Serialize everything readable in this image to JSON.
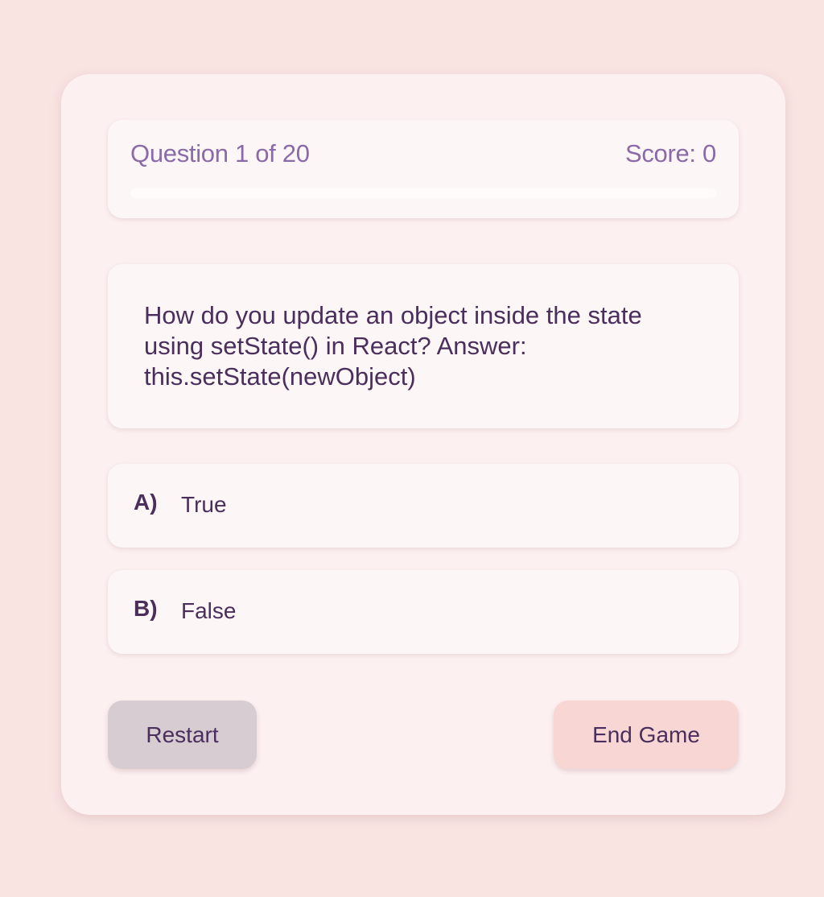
{
  "header": {
    "question_counter": "Question 1 of 20",
    "score": "Score: 0",
    "progress": {
      "current": 1,
      "total": 20,
      "fraction": 0
    }
  },
  "question": {
    "text": "How do you update an object inside the state using setState() in React? Answer: this.setState(newObject)"
  },
  "options": [
    {
      "letter": "A)",
      "label": "True"
    },
    {
      "letter": "B)",
      "label": "False"
    }
  ],
  "actions": {
    "restart_label": "Restart",
    "end_game_label": "End Game"
  },
  "colors": {
    "background": "#f9e4e2",
    "card": "#fcf0f0",
    "panel": "#fdf6f6",
    "text": "#4a2e5c",
    "accent_text": "#8a6aa8",
    "restart_button": "#d8ccd3",
    "end_game_button": "#f8d6d3"
  }
}
